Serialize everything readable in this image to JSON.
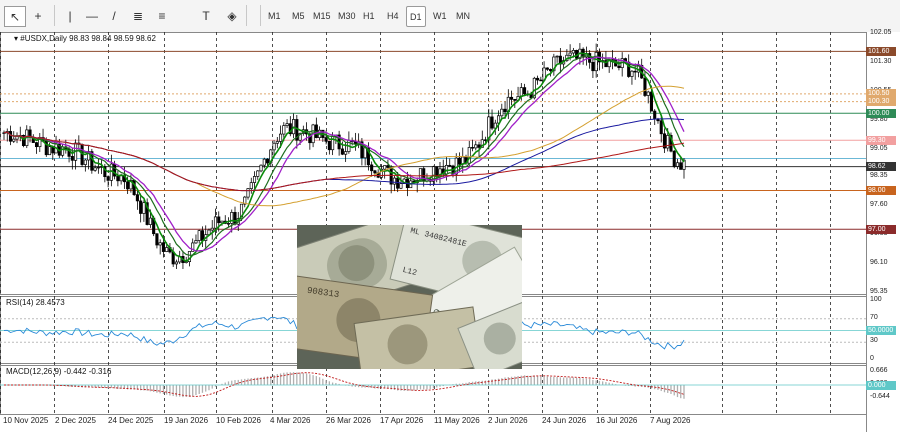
{
  "toolbar": {
    "tools": [
      {
        "name": "cursor-icon",
        "glyph": "↖",
        "active": true
      },
      {
        "name": "crosshair-icon",
        "glyph": "+"
      },
      {
        "name": "vertical-line-icon",
        "glyph": "|"
      },
      {
        "name": "horizontal-line-icon",
        "glyph": "—"
      },
      {
        "name": "trendline-icon",
        "glyph": "/"
      },
      {
        "name": "channel-icon",
        "glyph": "≣"
      },
      {
        "name": "fibonacci-icon",
        "glyph": "≡"
      },
      {
        "name": "text-icon",
        "glyph": "T"
      },
      {
        "name": "shapes-icon",
        "glyph": "◈"
      }
    ],
    "timeframes": [
      "M1",
      "M5",
      "M15",
      "M30",
      "H1",
      "H4",
      "D1",
      "W1",
      "MN"
    ],
    "active_timeframe": "D1"
  },
  "symbol_header": {
    "text": "#USDX,Daily  98.83 98.84 98.59 98.62"
  },
  "price_axis": {
    "ticks": [
      "102.05",
      "101.30",
      "100.55",
      "99.80",
      "99.05",
      "98.35",
      "97.60",
      "96.85",
      "96.10",
      "95.35"
    ],
    "levels": [
      {
        "label": "101.60",
        "value": 101.6,
        "color": "#8b4a2b"
      },
      {
        "label": "100.50",
        "value": 100.5,
        "color": "#e0a96d"
      },
      {
        "label": "100.30",
        "value": 100.3,
        "color": "#e0a96d"
      },
      {
        "label": "100.00",
        "value": 100.0,
        "color": "#2e8b57"
      },
      {
        "label": "99.30",
        "value": 99.3,
        "color": "#f2a0a0"
      },
      {
        "label": "98.62",
        "value": 98.62,
        "color": "#333333"
      },
      {
        "label": "98.00",
        "value": 98.0,
        "color": "#c8641e"
      },
      {
        "label": "97.00",
        "value": 97.0,
        "color": "#8b2b2b"
      }
    ]
  },
  "rsi": {
    "label": "RSI(14) 28.4573",
    "ticks": [
      "100",
      "70",
      "50",
      "30",
      "0"
    ],
    "level_label": "50.0000"
  },
  "macd": {
    "label": "MACD(12,26,9) -0.442 -0.316",
    "ticks": [
      "0.666",
      "0.000",
      "-0.644"
    ]
  },
  "time_axis": {
    "labels": [
      "10 Nov 2025",
      "2 Dec 2025",
      "24 Dec 2025",
      "19 Jan 2026",
      "10 Feb 2026",
      "4 Mar 2026",
      "26 Mar 2026",
      "17 Apr 2026",
      "11 May 2026",
      "2 Jun 2026",
      "24 Jun 2026",
      "16 Jul 2026",
      "7 Aug 2026"
    ]
  },
  "chart_data": {
    "type": "line",
    "title": "#USDX,Daily",
    "x": [
      "10 Nov 2025",
      "2 Dec 2025",
      "24 Dec 2025",
      "19 Jan 2026",
      "10 Feb 2026",
      "4 Mar 2026",
      "26 Mar 2026",
      "17 Apr 2026",
      "11 May 2026",
      "2 Jun 2026",
      "24 Jun 2026",
      "16 Jul 2026",
      "7 Aug 2026"
    ],
    "ylim": [
      95.35,
      102.05
    ],
    "ohlc_last": {
      "open": 98.83,
      "high": 98.84,
      "low": 98.59,
      "close": 98.62
    },
    "series": [
      {
        "values": [
          99.5,
          99.1,
          98.4,
          96.3,
          97.3,
          99.6,
          99.2,
          98.3,
          98.7,
          100.4,
          101.4,
          101.2,
          98.7
        ]
      }
    ],
    "grid": true
  }
}
